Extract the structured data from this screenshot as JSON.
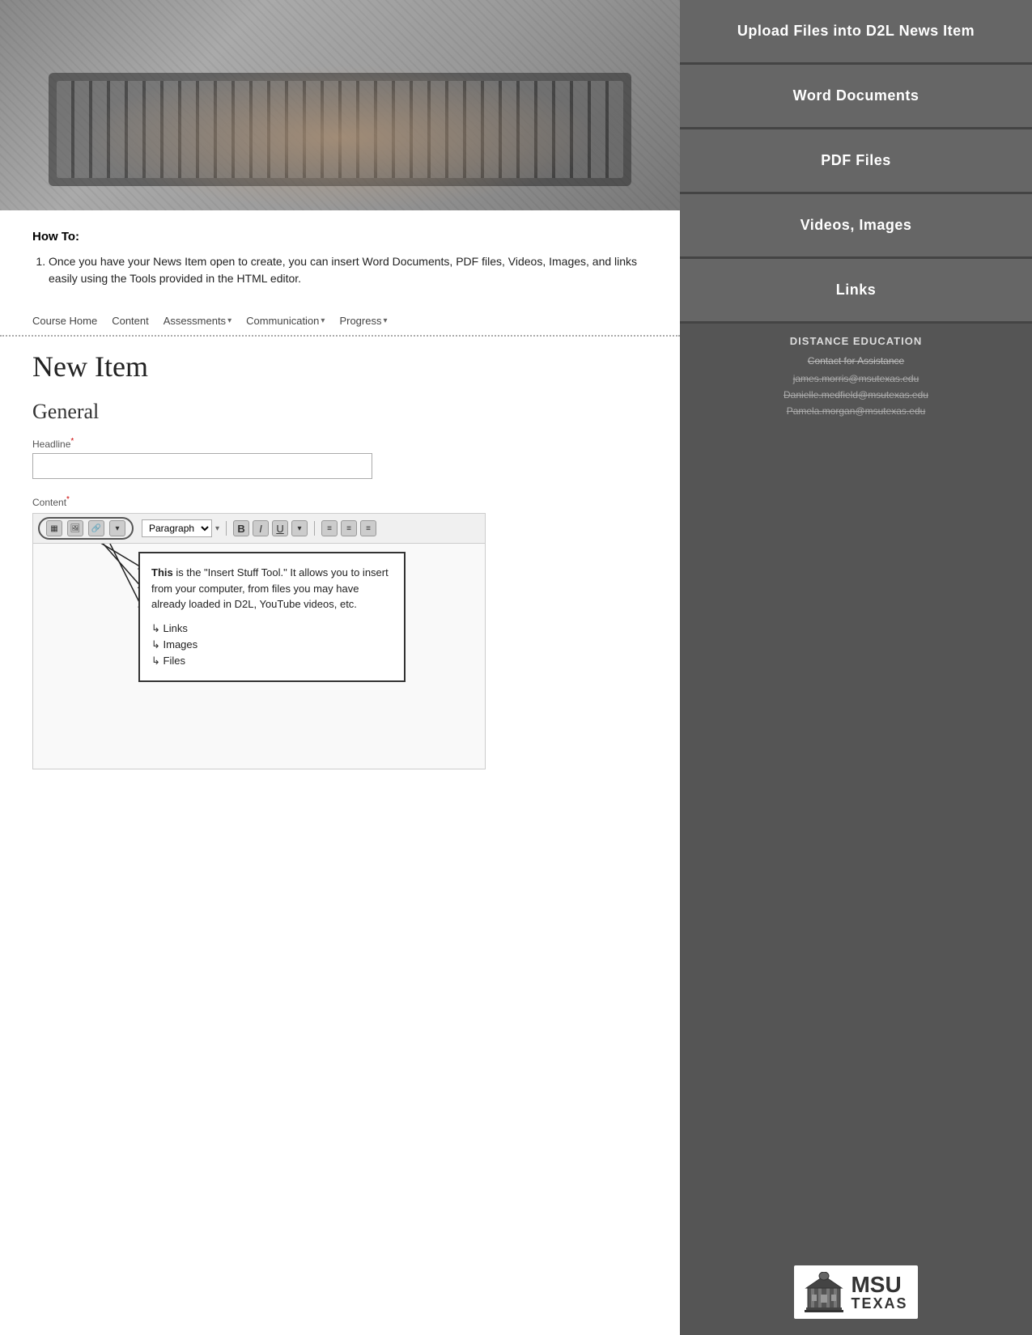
{
  "hero": {
    "alt": "Person typing on laptop keyboard"
  },
  "how_to": {
    "title": "How To:",
    "steps": [
      "Once you have your News Item open to create, you can insert Word Documents, PDF files, Videos, Images, and links easily using the Tools provided in the HTML editor."
    ]
  },
  "course_nav": {
    "items": [
      {
        "label": "Course Home",
        "has_dropdown": false
      },
      {
        "label": "Content",
        "has_dropdown": false
      },
      {
        "label": "Assessments",
        "has_dropdown": true
      },
      {
        "label": "Communication",
        "has_dropdown": true
      },
      {
        "label": "Progress",
        "has_dropdown": true
      }
    ]
  },
  "new_item": {
    "title": "New Item",
    "section_title": "General",
    "headline_label": "Headline",
    "content_label": "Content",
    "headline_placeholder": ""
  },
  "editor": {
    "paragraph_label": "Paragraph",
    "bold_label": "B",
    "italic_label": "I",
    "underline_label": "U"
  },
  "annotation": {
    "text": "This is the “Insert Stuff Tool.” It allows you to insert from your computer, from files you may have already loaded in D2L, YouTube videos, etc.",
    "items": [
      "Links",
      "Images",
      "Files"
    ]
  },
  "sidebar": {
    "menu_items": [
      {
        "label": "Upload Files into D2L News Item"
      },
      {
        "label": "Word Documents"
      },
      {
        "label": "PDF Files"
      },
      {
        "label": "Videos, Images"
      },
      {
        "label": "Links"
      }
    ],
    "distance_education": {
      "title": "DISTANCE EDUCATION",
      "contact_label": "Contact for Assistance",
      "emails": [
        "james.morris@msutexas.edu",
        "Danielle.medfield@msutexas.edu",
        "Pamela.morgan@msutexas.edu"
      ]
    },
    "logo": {
      "msu": "MSU",
      "texas": "TEXAS"
    }
  }
}
